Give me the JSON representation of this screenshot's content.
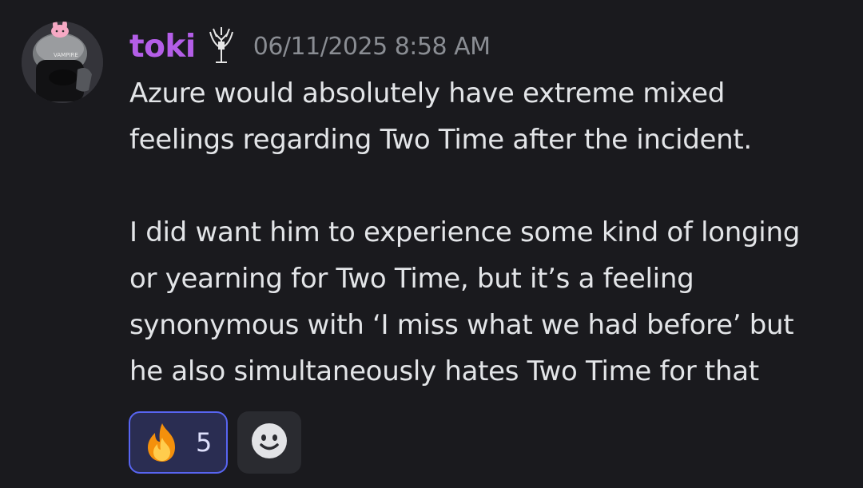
{
  "message": {
    "author": "toki",
    "timestamp": "06/11/2025 8:58 AM",
    "paragraphs": [
      {
        "lines": [
          "Azure would absolutely have extreme mixed",
          "feelings regarding Two Time after the incident."
        ]
      },
      {
        "lines": [
          "I did want him to experience some kind of longing",
          "or yearning for Two Time, but it’s a feeling",
          "synonymous with ‘I miss what we had before’ but",
          "he also simultaneously hates Two Time for that"
        ]
      }
    ],
    "avatar_text": "VAMPIRE"
  },
  "reactions": [
    {
      "emoji": "fire-icon",
      "count": "5",
      "selected": true
    }
  ],
  "add_reaction_icon": "smiley-add-reaction-icon",
  "colors": {
    "background": "#1a1a1e",
    "username": "#b45ee8",
    "timestamp": "#8a8d93",
    "text": "#e3e5e8",
    "reaction_border": "#5865f2",
    "reaction_bg": "#2a2d52"
  }
}
